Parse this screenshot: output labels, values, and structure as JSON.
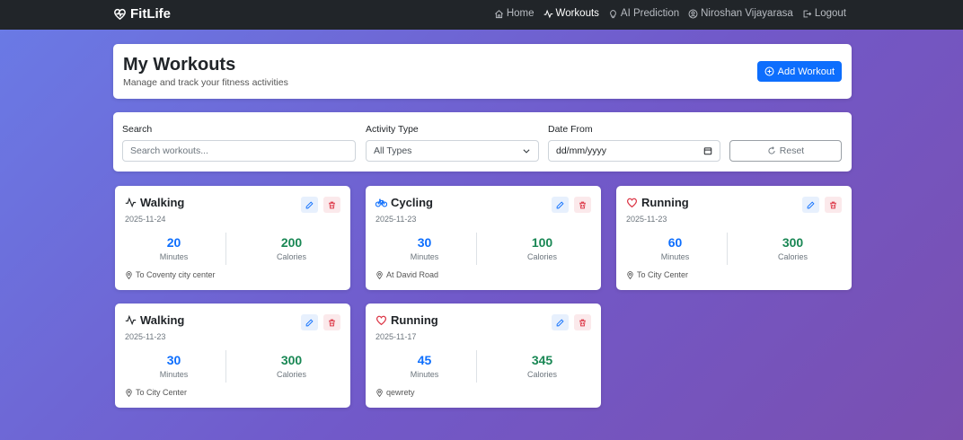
{
  "nav": {
    "brand": "FitLife",
    "links": [
      {
        "label": "Home",
        "icon": "home-icon"
      },
      {
        "label": "Workouts",
        "icon": "activity-icon"
      },
      {
        "label": "AI Prediction",
        "icon": "lightbulb-icon"
      },
      {
        "label": "Niroshan Vijayarasa",
        "icon": "user-circle-icon"
      },
      {
        "label": "Logout",
        "icon": "logout-icon"
      }
    ]
  },
  "header": {
    "title": "My Workouts",
    "subtitle": "Manage and track your fitness activities",
    "add_label": "Add Workout"
  },
  "filters": {
    "search_label": "Search",
    "search_placeholder": "Search workouts...",
    "type_label": "Activity Type",
    "type_value": "All Types",
    "date_label": "Date From",
    "date_placeholder": "dd/mm/yyyy",
    "reset_label": "Reset"
  },
  "workouts": [
    {
      "type": "Walking",
      "icon": "activity-icon",
      "date": "2025-11-24",
      "minutes": "20",
      "calories": "200",
      "location": "To Coventy city center"
    },
    {
      "type": "Cycling",
      "icon": "bicycle-icon",
      "date": "2025-11-23",
      "minutes": "30",
      "calories": "100",
      "location": "At David Road"
    },
    {
      "type": "Running",
      "icon": "heart-icon",
      "date": "2025-11-23",
      "minutes": "60",
      "calories": "300",
      "location": "To City Center"
    },
    {
      "type": "Walking",
      "icon": "activity-icon",
      "date": "2025-11-23",
      "minutes": "30",
      "calories": "300",
      "location": "To City Center"
    },
    {
      "type": "Running",
      "icon": "heart-icon",
      "date": "2025-11-17",
      "minutes": "45",
      "calories": "345",
      "location": "qewrety"
    }
  ],
  "labels": {
    "minutes": "Minutes",
    "calories": "Calories"
  },
  "colors": {
    "primary": "#0d6efd",
    "success": "#198754",
    "danger": "#dc3545",
    "navbar": "#212529"
  }
}
